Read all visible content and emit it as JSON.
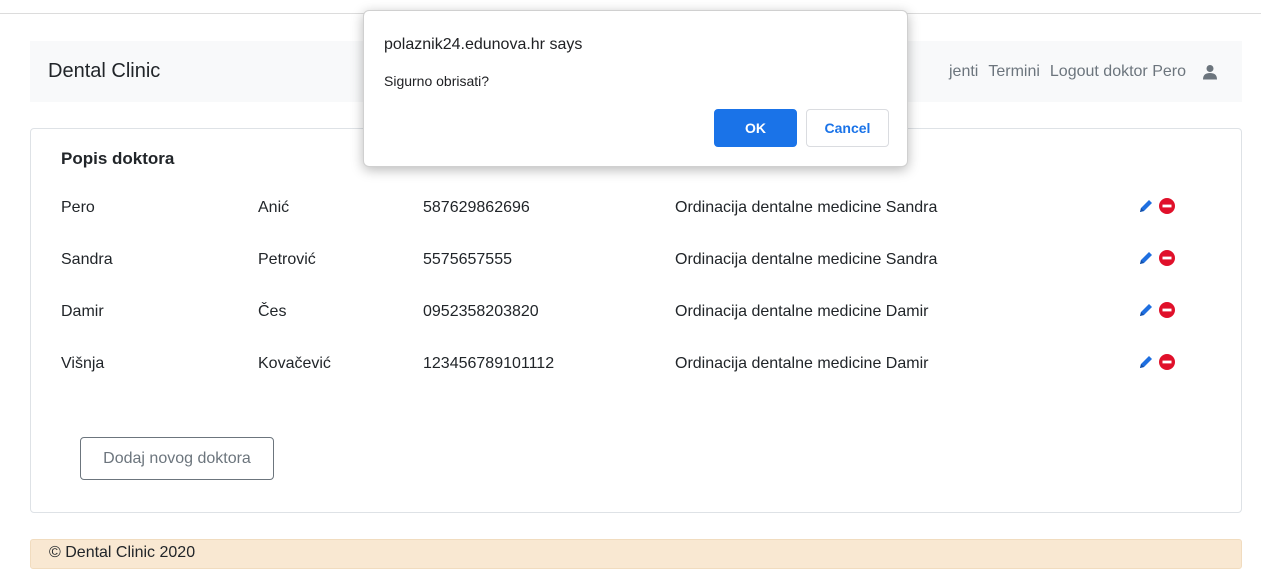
{
  "navbar": {
    "brand": "Dental Clinic",
    "links": [
      "jenti",
      "Termini",
      "Logout doktor Pero"
    ],
    "icons": {
      "user": "user-icon"
    }
  },
  "card": {
    "title": "Popis doktora",
    "rows": [
      {
        "first_name": "Pero",
        "last_name": "Anić",
        "oib": "587629862696",
        "clinic": "Ordinacija dentalne medicine Sandra"
      },
      {
        "first_name": "Sandra",
        "last_name": "Petrović",
        "oib": "5575657555",
        "clinic": "Ordinacija dentalne medicine Sandra"
      },
      {
        "first_name": "Damir",
        "last_name": "Čes",
        "oib": "0952358203820",
        "clinic": "Ordinacija dentalne medicine Damir"
      },
      {
        "first_name": "Višnja",
        "last_name": "Kovačević",
        "oib": "123456789101112",
        "clinic": "Ordinacija dentalne medicine Damir"
      }
    ],
    "row_icons": {
      "edit": "pencil-icon",
      "delete": "minus-circle-icon"
    },
    "add_button": "Dodaj novog doktora"
  },
  "footer": {
    "text": "© Dental Clinic 2020"
  },
  "dialog": {
    "title": "polaznik24.edunova.hr says",
    "message": "Sigurno obrisati?",
    "ok": "OK",
    "cancel": "Cancel"
  },
  "colors": {
    "edit_icon": "#1f6fe0",
    "delete_icon": "#e0102a",
    "dialog_primary": "#1a73e8",
    "footer_bg": "#f9e8d2",
    "navbar_bg": "#f8f9fa"
  }
}
